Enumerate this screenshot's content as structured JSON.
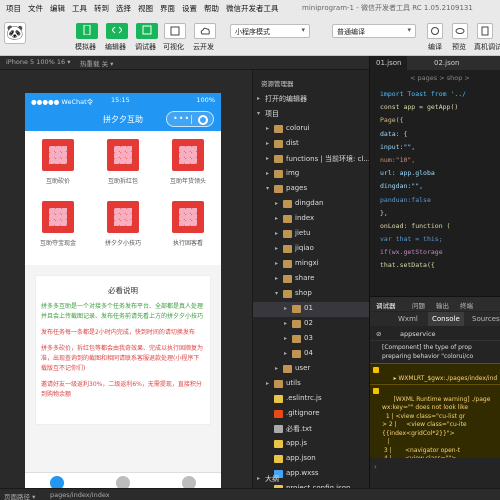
{
  "menu": [
    "项目",
    "文件",
    "编辑",
    "工具",
    "转到",
    "选择",
    "视图",
    "界面",
    "设置",
    "帮助",
    "微信开发者工具"
  ],
  "window_title": "miniprogram-1 - 微信开发者工具 RC 1.05.2109131",
  "toolbar": {
    "labels": [
      "模拟器",
      "编辑器",
      "调试器",
      "可视化",
      "云开发"
    ],
    "mode_select": "小程序模式",
    "compile_select": "普通编译",
    "right_labels": [
      "编译",
      "预览",
      "真机调试"
    ]
  },
  "subbar": {
    "device": "iPhone 5 100% 16 ▾",
    "hotreload": "热重载 关 ▾"
  },
  "phone": {
    "status": {
      "carrier": "●●●●● WeChat令",
      "time": "15:15",
      "battery": "100%"
    },
    "nav_title": "拼夕夕互助",
    "grid_items": [
      "互助砍价",
      "互助拆红包",
      "互助年货领头",
      "互助夺宝现金",
      "拼夕夕小技巧",
      "执行固客看"
    ],
    "notice": {
      "title": "必看说明",
      "paras": [
        "拼多多互助是一个对接多个任务发布平台、全部都是真人处理并且会上传截图记录、发布任务前请先看上方的拼夕夕小技巧",
        "发布任务每一条都是2小时内完成，快到时间的请切换发布",
        "拼多多砍价，拆红包等都会由我奇效果、完成以执行固顺复为准，出现查询到的截图和相同请联系客服退款处理(小程序下载版互不记你们)",
        "邀请好友一级返利30%，二级返利6%，无需提现，直接积分到购物余额"
      ]
    },
    "tabs": [
      "首页",
      "订单",
      "我的"
    ]
  },
  "explorer": {
    "header": "资源管理器",
    "items": [
      {
        "name": "打开的编辑器",
        "level": 0,
        "arrow": "▸"
      },
      {
        "name": "项目",
        "level": 0,
        "arrow": "▾"
      },
      {
        "name": "colorui",
        "level": 1,
        "arrow": "▸",
        "type": "folder"
      },
      {
        "name": "dist",
        "level": 1,
        "arrow": "▸",
        "type": "folder"
      },
      {
        "name": "functions | 当前环境: cl...",
        "level": 1,
        "arrow": "▸",
        "type": "folder"
      },
      {
        "name": "img",
        "level": 1,
        "arrow": "▸",
        "type": "folder"
      },
      {
        "name": "pages",
        "level": 1,
        "arrow": "▾",
        "type": "folder"
      },
      {
        "name": "dingdan",
        "level": 2,
        "arrow": "▸",
        "type": "folder"
      },
      {
        "name": "index",
        "level": 2,
        "arrow": "▸",
        "type": "folder"
      },
      {
        "name": "jietu",
        "level": 2,
        "arrow": "▸",
        "type": "folder"
      },
      {
        "name": "jiqiao",
        "level": 2,
        "arrow": "▸",
        "type": "folder"
      },
      {
        "name": "mingxi",
        "level": 2,
        "arrow": "▸",
        "type": "folder"
      },
      {
        "name": "share",
        "level": 2,
        "arrow": "▸",
        "type": "folder"
      },
      {
        "name": "shop",
        "level": 2,
        "arrow": "▾",
        "type": "folder"
      },
      {
        "name": "01",
        "level": 3,
        "arrow": "▸",
        "type": "folder",
        "selected": true
      },
      {
        "name": "02",
        "level": 3,
        "arrow": "▸",
        "type": "folder"
      },
      {
        "name": "03",
        "level": 3,
        "arrow": "▸",
        "type": "folder"
      },
      {
        "name": "04",
        "level": 3,
        "arrow": "▸",
        "type": "folder"
      },
      {
        "name": "user",
        "level": 2,
        "arrow": "▸",
        "type": "folder"
      },
      {
        "name": "utils",
        "level": 1,
        "arrow": "▸",
        "type": "folder"
      },
      {
        "name": ".eslintrc.js",
        "level": 1,
        "arrow": "",
        "type": "js"
      },
      {
        "name": ".gitignore",
        "level": 1,
        "arrow": "",
        "type": "git"
      },
      {
        "name": "必看.txt",
        "level": 1,
        "arrow": "",
        "type": "txt"
      },
      {
        "name": "app.js",
        "level": 1,
        "arrow": "",
        "type": "js"
      },
      {
        "name": "app.json",
        "level": 1,
        "arrow": "",
        "type": "json"
      },
      {
        "name": "app.wxss",
        "level": 1,
        "arrow": "",
        "type": "wxss"
      },
      {
        "name": "project.config.json",
        "level": 1,
        "arrow": "",
        "type": "json"
      },
      {
        "name": "sitemap.json",
        "level": 1,
        "arrow": "",
        "type": "json"
      }
    ],
    "outline": "大纲"
  },
  "editor": {
    "tabs": [
      "01.json",
      "02.json"
    ],
    "breadcrumb": "<   pages > shop > ",
    "lines": [
      {
        "text": "import Toast from '../",
        "color": "#4fc1ff"
      },
      {
        "text": "const app = getApp()",
        "color": "#dcdcaa"
      },
      {
        "text": "Page({",
        "color": "#d7ba7d"
      },
      {
        "text": "    data: {",
        "color": "#9cdcfe"
      },
      {
        "text": "        input:\"\",",
        "color": "#9cdcfe"
      },
      {
        "text": "        num:\"10\",",
        "color": "#ce9178"
      },
      {
        "text": "        url: app.globa",
        "color": "#9cdcfe"
      },
      {
        "text": "        dingdan:\"\",",
        "color": "#9cdcfe"
      },
      {
        "text": "        panduan:false",
        "color": "#569cd6"
      },
      {
        "text": "    },",
        "color": "#d4d4d4"
      },
      {
        "text": "    onLoad: function (",
        "color": "#dcdcaa"
      },
      {
        "text": "        var that = this;",
        "color": "#569cd6"
      },
      {
        "text": "        if(wx.getStorage",
        "color": "#c586c0"
      },
      {
        "text": "            that.setData({",
        "color": "#dcdcaa"
      }
    ]
  },
  "debugger": {
    "tabs": [
      "调试器",
      "问题",
      "输出",
      "终端"
    ],
    "console_tabs": [
      "Wxml",
      "Console",
      "Sources"
    ],
    "context": "appservice",
    "logs": [
      "[Component] the type of prop\npreparing behavior \"colorui/co",
      "▸ WXMLRT_$gwx:./pages/index/ind\nvalid key name.",
      "[WXML Runtime warning] ./page\nwx:key=\"\" does not look like\n  1 | <view class=\"cu-list gr\n> 2 |     <view class=\"cu-ite\n{{index<gridCol*2}}\">\n   |\n 3 |       <navigator open-t\n 4 |       <view class=\"\">"
    ]
  },
  "statusbar": {
    "path_label": "页面路径 ▾",
    "path": "pages/index/index"
  }
}
